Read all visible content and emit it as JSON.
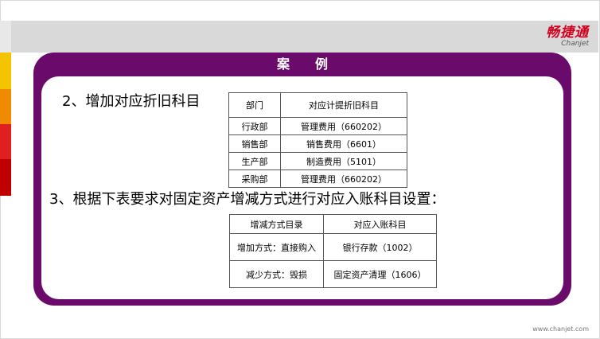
{
  "slide": {
    "title": "案　例",
    "brand_cn": "畅捷通",
    "brand_en": "Chanjet",
    "heading1": "2、增加对应折旧科目",
    "table1": {
      "headers": [
        "部门",
        "对应计提折旧科目"
      ],
      "rows": [
        [
          "行政部",
          "管理费用（660202）"
        ],
        [
          "销售部",
          "销售费用（6601）"
        ],
        [
          "生产部",
          "制造费用（5101）"
        ],
        [
          "采购部",
          "管理费用（660202）"
        ]
      ]
    },
    "heading2": "3、根据下表要求对固定资产增减方式进行对应入账科目设置：",
    "table2": {
      "headers": [
        "增减方式目录",
        "对应入账科目"
      ],
      "rows": [
        [
          "增加方式：直接购入",
          "银行存款（1002）"
        ],
        [
          "减少方式：毁损",
          "固定资产清理（1606）"
        ]
      ]
    },
    "footer_url": "www.chanjet.com"
  },
  "colors": {
    "frame_purple": "#6a0a6a",
    "brand_red": "#d2001f",
    "band_gray": "#d9d9d9",
    "strip_light": "#e8e8e8",
    "strip_yellow": "#f5c400",
    "strip_orange": "#f08a00",
    "strip_red": "#e02020",
    "strip_darkred": "#c00000"
  }
}
